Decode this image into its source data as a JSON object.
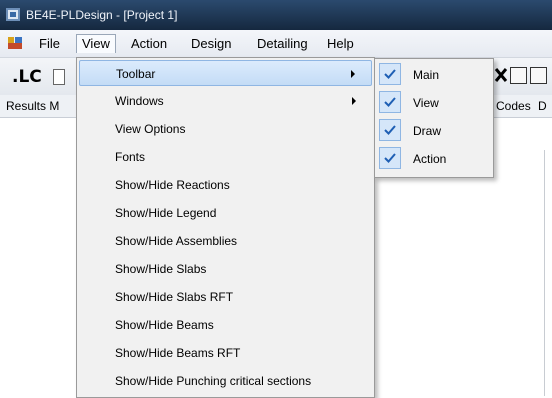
{
  "window": {
    "title": "BE4E-PLDesign - [Project 1]",
    "app_icon": "app-icon"
  },
  "menubar": {
    "items": [
      {
        "label": "File",
        "active": false
      },
      {
        "label": "View",
        "active": true
      },
      {
        "label": "Action",
        "active": false
      },
      {
        "label": "Design",
        "active": false
      },
      {
        "label": "Detailing",
        "active": false
      },
      {
        "label": "Help",
        "active": false
      }
    ]
  },
  "toolbar": {
    "lc_label": ".LC"
  },
  "tabs": {
    "left_text": "Results M",
    "right_text_1": "Codes",
    "right_text_2": "D"
  },
  "view_menu": {
    "items": [
      {
        "label": "Toolbar",
        "has_submenu": true,
        "highlighted": true
      },
      {
        "label": "Windows",
        "has_submenu": true
      },
      {
        "label": "View Options"
      },
      {
        "label": "Fonts"
      },
      {
        "label": "Show/Hide Reactions"
      },
      {
        "label": "Show/Hide Legend"
      },
      {
        "label": "Show/Hide Assemblies"
      },
      {
        "label": "Show/Hide Slabs"
      },
      {
        "label": "Show/Hide Slabs RFT"
      },
      {
        "label": "Show/Hide Beams"
      },
      {
        "label": "Show/Hide Beams RFT"
      },
      {
        "label": "Show/Hide Punching critical sections"
      }
    ]
  },
  "toolbar_submenu": {
    "items": [
      {
        "label": "Main",
        "checked": true
      },
      {
        "label": "View",
        "checked": true
      },
      {
        "label": "Draw",
        "checked": true
      },
      {
        "label": "Action",
        "checked": true
      }
    ]
  },
  "colors": {
    "highlight": "#c4dcf6",
    "check_bg": "#d5e6f9",
    "check_mark": "#1f5fb4",
    "titlebar": "#1f3756"
  }
}
